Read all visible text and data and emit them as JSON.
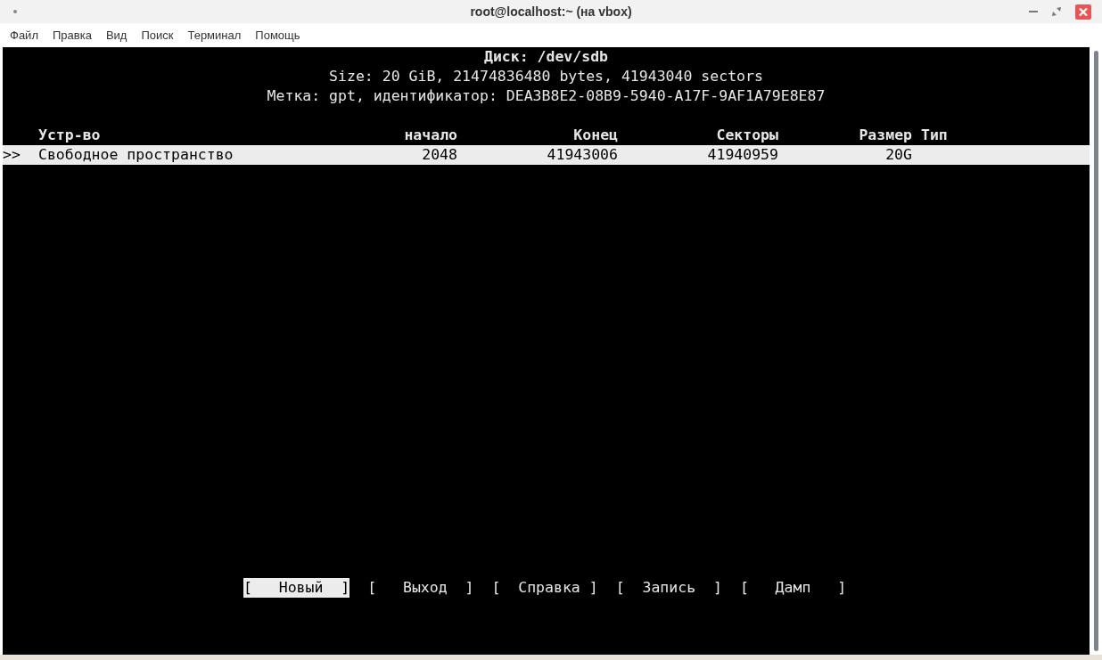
{
  "window": {
    "title": "root@localhost:~ (на vbox)"
  },
  "menu": [
    "Файл",
    "Правка",
    "Вид",
    "Поиск",
    "Терминал",
    "Помощь"
  ],
  "disk": {
    "title": "Диск: /dev/sdb",
    "size_line": "Size: 20 GiB, 21474836480 bytes, 41943040 sectors",
    "label_line": "Метка: gpt, идентификатор: DEA3B8E2-08B9-5940-A17F-9AF1A79E8E87"
  },
  "table": {
    "columns": [
      "Устр-во",
      "начало",
      "Конец",
      "Секторы",
      "Размер",
      "Тип"
    ],
    "rows": [
      {
        "marker": ">>",
        "cells": [
          "Свободное пространство",
          "2048",
          "41943006",
          "41940959",
          "20G",
          ""
        ],
        "selected": true
      }
    ]
  },
  "actions": [
    {
      "label": "[   Новый  ]",
      "selected": true
    },
    {
      "label": "[   Выход  ]",
      "selected": false
    },
    {
      "label": "[  Справка ]",
      "selected": false
    },
    {
      "label": "[  Запись  ]",
      "selected": false
    },
    {
      "label": "[   Дамп   ]",
      "selected": false
    }
  ]
}
